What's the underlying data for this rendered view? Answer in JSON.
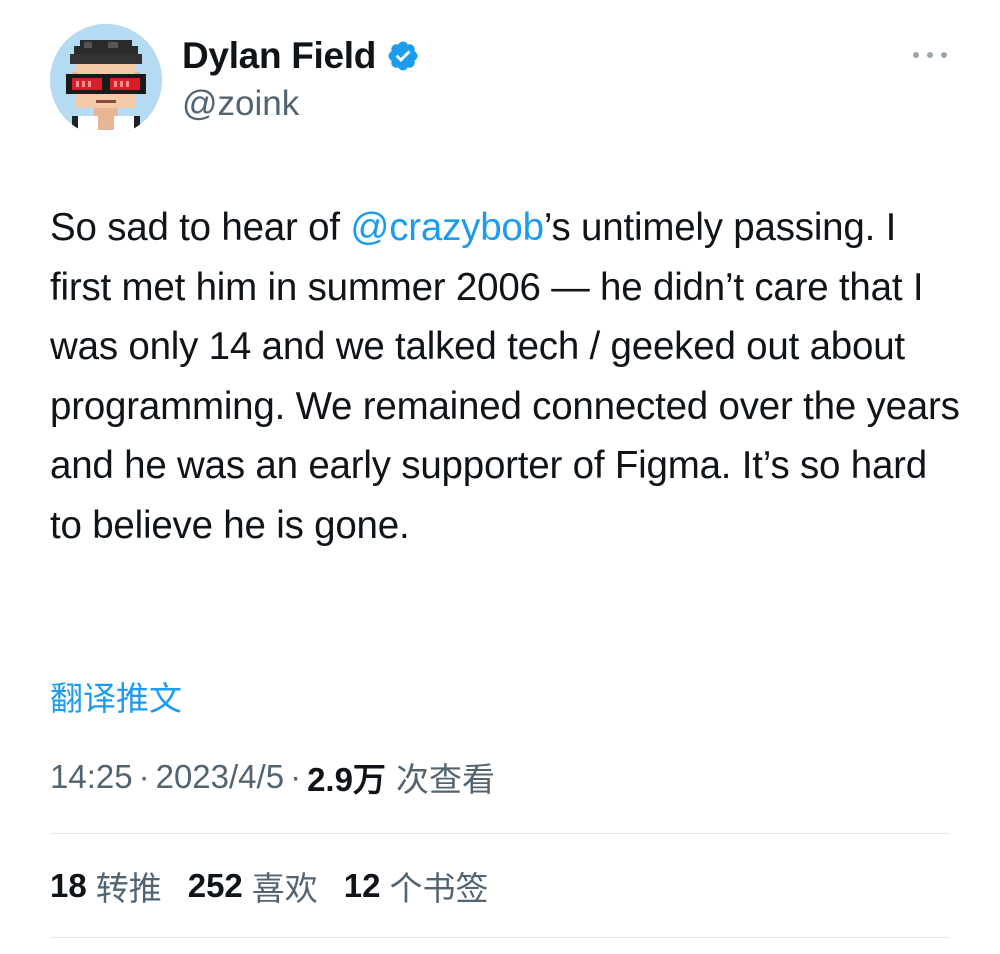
{
  "colors": {
    "accent": "#1d9bf0",
    "text": "#0f1419",
    "secondary": "#536471",
    "divider": "#e4e8eb",
    "avatar_bg": "#b5dbf2"
  },
  "author": {
    "display_name": "Dylan Field",
    "handle": "@zoink",
    "verified_icon": "verified-badge-icon",
    "avatar_icon": "pixel-avatar-with-visor"
  },
  "more_icon": "more-dots-icon",
  "tweet": {
    "text_before_mention": "So sad to hear of ",
    "mention": "@crazybob",
    "text_after_mention": "’s untimely passing. I first met him in summer 2006 — he didn’t care that I was only 14 and we talked tech / geeked out about programming. We remained connected over the years and he was an early supporter of Figma. It’s so hard to believe he is gone.",
    "translate_label": "翻译推文"
  },
  "meta": {
    "time": "14:25",
    "separator": "·",
    "date": "2023/4/5",
    "views_count": "2.9万",
    "views_label": "次查看"
  },
  "stats": {
    "retweets_count": "18",
    "retweets_label": "转推",
    "likes_count": "252",
    "likes_label": "喜欢",
    "bookmarks_count": "12",
    "bookmarks_label": "个书签"
  }
}
